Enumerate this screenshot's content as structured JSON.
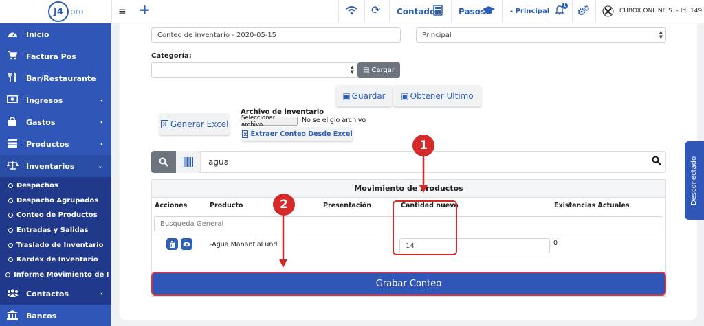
{
  "topbar": {
    "logo": "J4",
    "logo_suffix": "pro",
    "menu_icon": "hamburger-icon",
    "add_icon": "plus-icon",
    "contador": "Contador",
    "pasos": "Pasos",
    "branch": "- Principal",
    "notif_count": "1",
    "company": "CUBOX ONLINE S. - Id: 149"
  },
  "sidebar": {
    "items": [
      {
        "label": "Inicio",
        "icon": "dashboard-icon"
      },
      {
        "label": "Factura Pos",
        "icon": "cart-icon"
      },
      {
        "label": "Bar/Restaurante",
        "icon": "cutlery-icon"
      },
      {
        "label": "Ingresos",
        "icon": "money-icon"
      },
      {
        "label": "Gastos",
        "icon": "shopping-bag-icon"
      },
      {
        "label": "Productos",
        "icon": "list-icon"
      },
      {
        "label": "Inventarios",
        "icon": "balance-scale-icon"
      },
      {
        "label": "Contactos",
        "icon": "users-icon"
      },
      {
        "label": "Bancos",
        "icon": "bank-icon"
      }
    ],
    "subitems": [
      "Despachos",
      "Despacho Agrupados",
      "Conteo de Productos",
      "Entradas y Salidas",
      "Traslado de Inventario",
      "Kardex de Inventario",
      "Informe Movimiento de Inve"
    ]
  },
  "form": {
    "conteo_value": "Conteo de inventario - 2020-05-15",
    "branch_value": "Principal",
    "categoria_label": "Categoría:",
    "categoria_value": "",
    "cargar": "Cargar",
    "guardar": "Guardar",
    "obtener": "Obtener Ultimo",
    "generar_excel": "Generar Excel",
    "archivo_label": "Archivo de inventario",
    "file_button": "Seleccionar archivo",
    "file_status": "No se eligió archivo",
    "extraer": "Extraer Conteo Desde Excel"
  },
  "search": {
    "value": "agua"
  },
  "table": {
    "title": "Movimiento de Productos",
    "headers": [
      "Acciones",
      "Producto",
      "Presentación",
      "Cantidad nueva",
      "Existencias Actuales"
    ],
    "filter_placeholder": "Busqueda General",
    "rows": [
      {
        "producto": "-Agua Manantial und",
        "presentacion": "",
        "cantidad": "14",
        "existencias": "0"
      }
    ]
  },
  "grabar": "Grabar Conteo",
  "side_tab": "Desconectado",
  "annotations": [
    "1",
    "2"
  ],
  "colors": {
    "primary": "#3057b8",
    "sidebar_sub": "#20398a",
    "annotation": "#d42a2a"
  }
}
